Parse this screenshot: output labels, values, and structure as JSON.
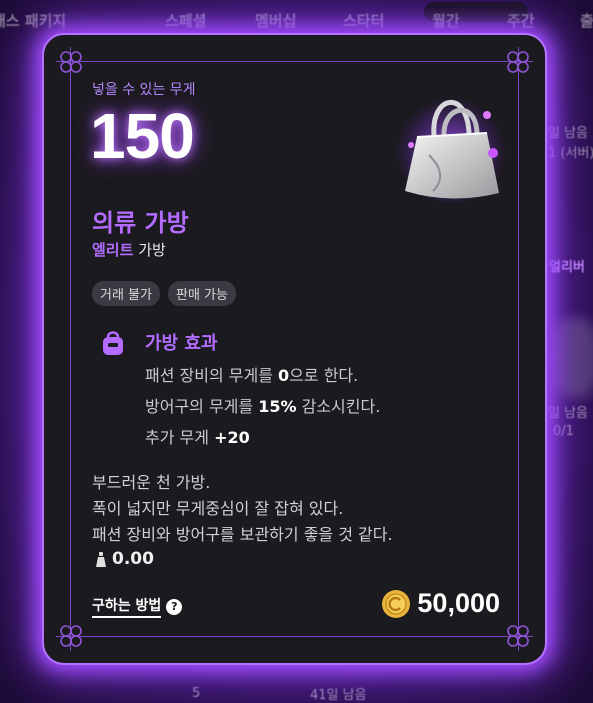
{
  "background": {
    "tabs": [
      "패스 패키지",
      "스페셜",
      "멤버십",
      "스타터",
      "월간",
      "주간",
      "출"
    ],
    "side_texts": [
      "일 남음",
      "1 (서버)",
      "얼리버",
      "일 남음",
      "0/1",
      "5",
      "41일 남음"
    ]
  },
  "tooltip": {
    "weight_label": "넣을 수 있는 무게",
    "weight_value": "150",
    "item_name": "의류 가방",
    "grade": "엘리트",
    "grade_suffix": "가방",
    "tags": [
      "거래 불가",
      "판매 가능"
    ],
    "effect": {
      "title": "가방 효과",
      "lines": [
        {
          "pre": "패션 장비의 무게를 ",
          "bold": "0",
          "post": "으로 한다."
        },
        {
          "pre": "방어구의 무게를 ",
          "bold": "15%",
          "post": " 감소시킨다."
        },
        {
          "pre": "추가 무게 ",
          "bold": "+20",
          "post": ""
        }
      ]
    },
    "description": [
      "부드러운 천 가방.",
      "폭이 넓지만 무게중심이 잘 잡혀 있다.",
      "패션 장비와 방어구를 보관하기 좋을 것 같다."
    ],
    "item_weight": "0.00",
    "how_to_get": "구하는 방법",
    "price": "50,000"
  },
  "colors": {
    "accent_purple": "#b36cff",
    "glow": "#a24cff",
    "card_bg": "#1b1a1f",
    "coin_gold": "#e9b53a"
  },
  "icons": [
    "bag-icon",
    "weight-icon",
    "help-icon",
    "gold-coin-icon",
    "corner-ornament-icon"
  ]
}
